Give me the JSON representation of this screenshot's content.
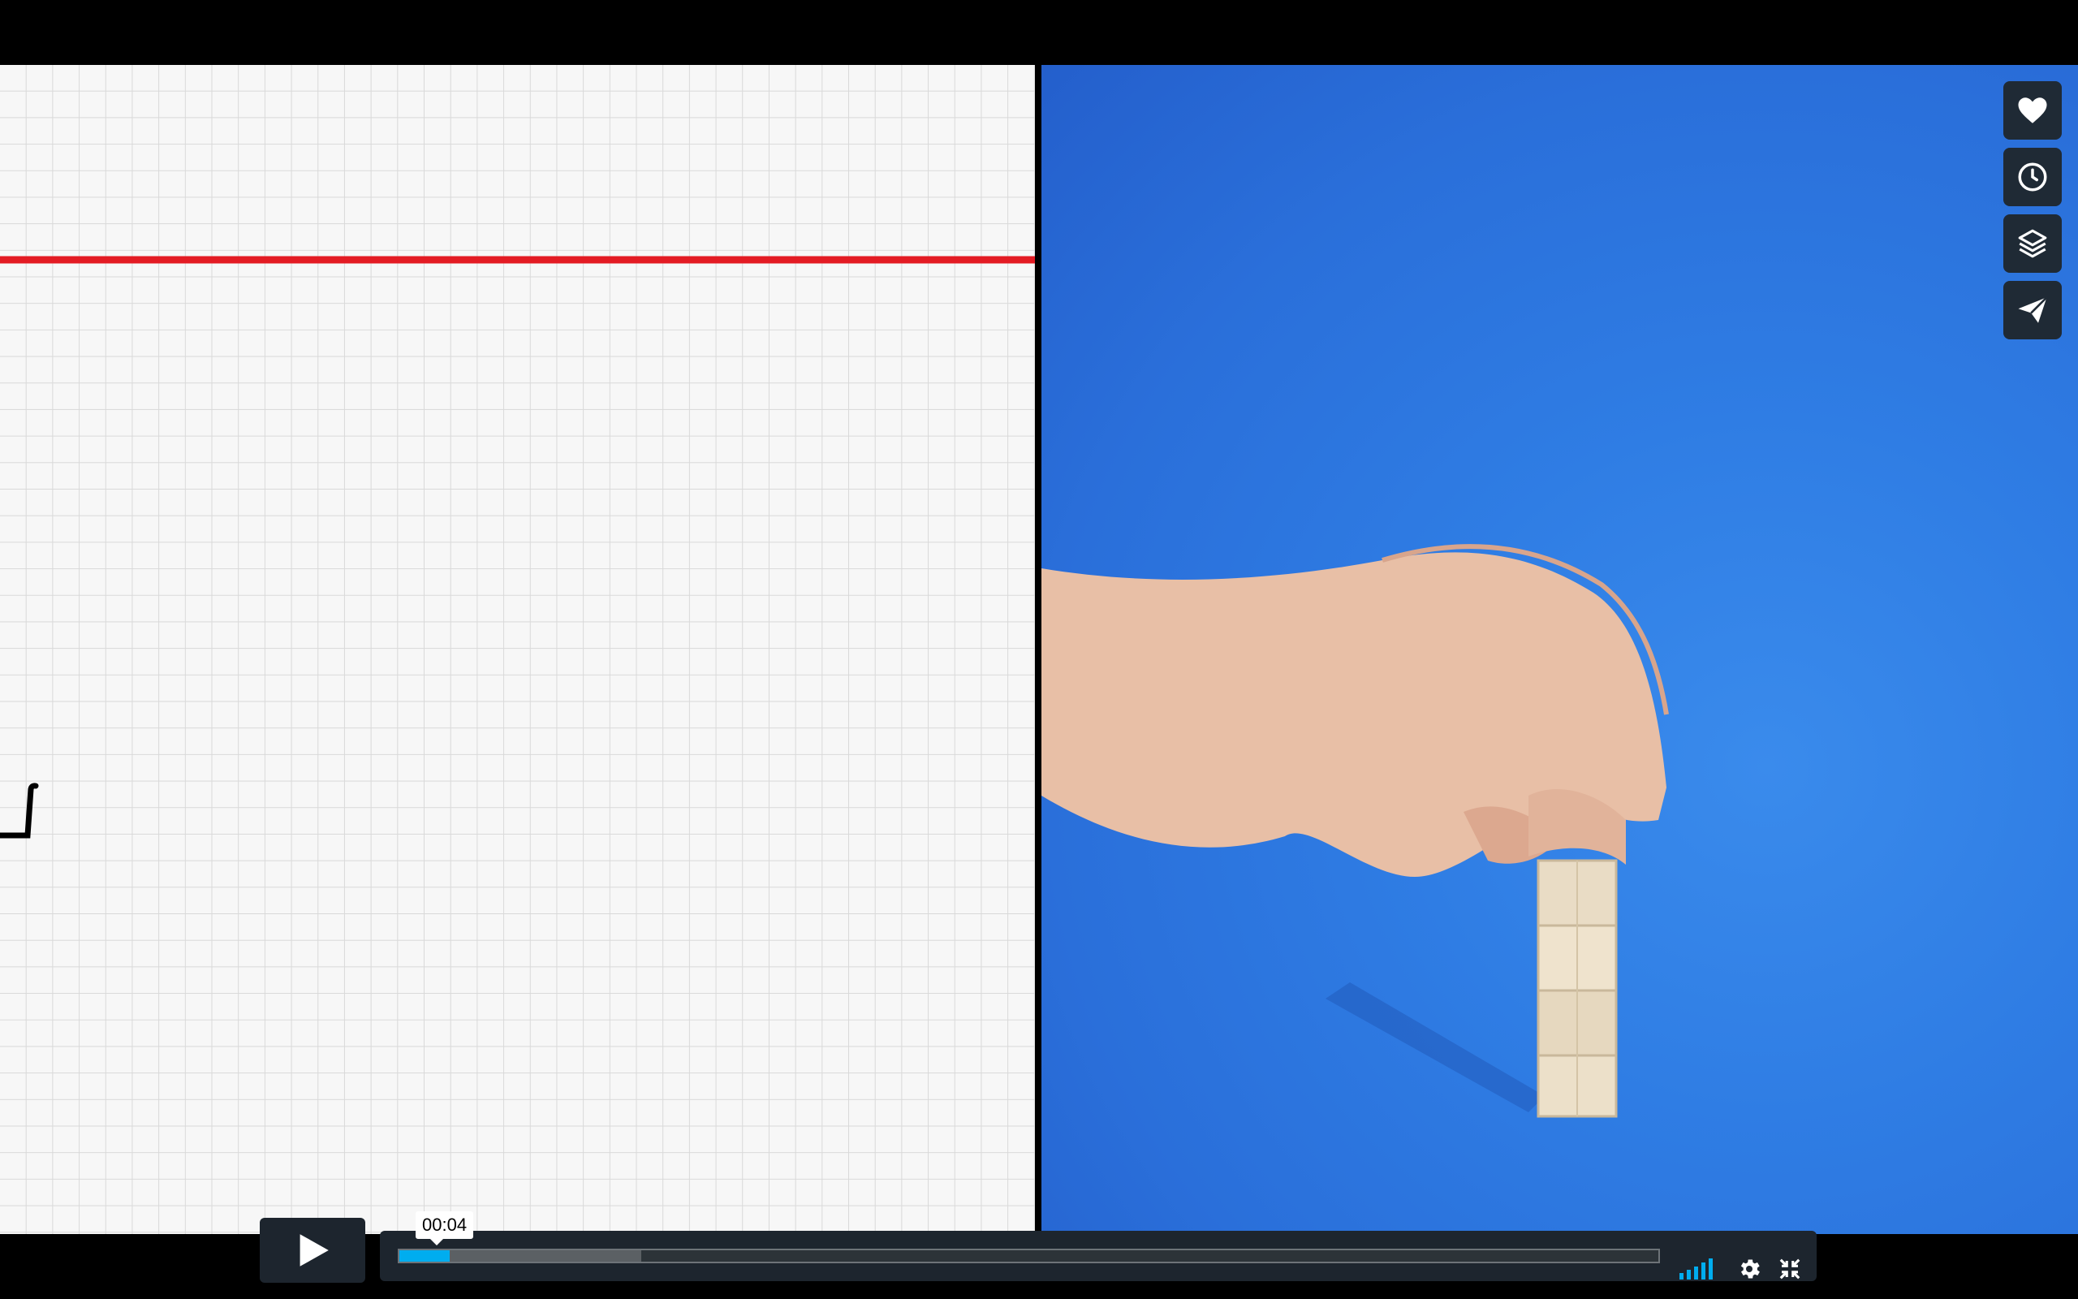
{
  "player": {
    "current_time": "00:04",
    "progress_fraction": 0.04,
    "buffered_fraction": 0.192
  },
  "side_actions": [
    {
      "name": "like",
      "icon": "heart-icon"
    },
    {
      "name": "watch-later",
      "icon": "clock-icon"
    },
    {
      "name": "collections",
      "icon": "layers-icon"
    },
    {
      "name": "share",
      "icon": "paper-plane-icon"
    }
  ],
  "controls": [
    {
      "name": "play",
      "icon": "play-icon"
    },
    {
      "name": "quality",
      "icon": "signal-bars-icon"
    },
    {
      "name": "settings",
      "icon": "gear-icon"
    },
    {
      "name": "fullscreen",
      "icon": "fullscreen-exit-icon"
    }
  ],
  "colors": {
    "accent": "#00adef",
    "graph_line": "#e31b23",
    "background_blue": "#2f7de4"
  }
}
